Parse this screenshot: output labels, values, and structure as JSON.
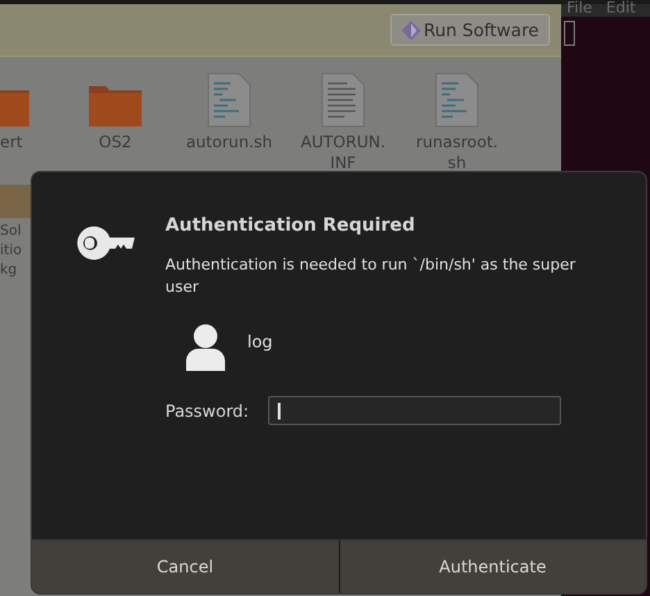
{
  "file_manager": {
    "infobar": {
      "button": "Run Software"
    },
    "files": [
      {
        "name": "ert",
        "kind": "folder"
      },
      {
        "name": "OS2",
        "kind": "folder"
      },
      {
        "name": "autorun.sh",
        "kind": "script"
      },
      {
        "name": "AUTORUN.\nINF",
        "kind": "text"
      },
      {
        "name": "runasroot.\nsh",
        "kind": "script"
      }
    ],
    "partial_file": {
      "name": "Sol\nitio\nkg",
      "kind": "package"
    }
  },
  "terminal_menu": [
    "File",
    "Edit"
  ],
  "dialog": {
    "title": "Authentication Required",
    "message": "Authentication is needed to run `/bin/sh' as the super user",
    "user": "log",
    "password_label": "Password:",
    "password": {
      "focused": true
    },
    "buttons": [
      "Cancel",
      "Authenticate"
    ]
  }
}
